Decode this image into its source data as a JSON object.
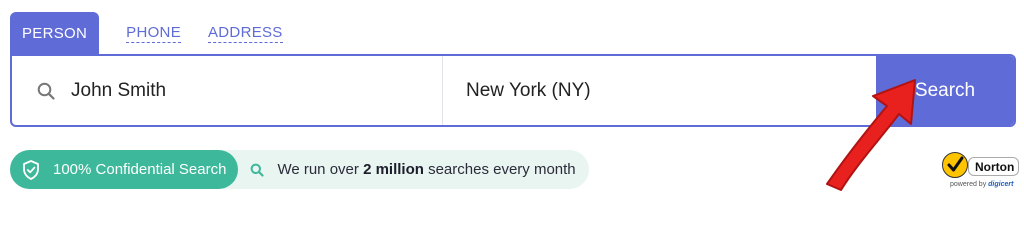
{
  "tabs": [
    {
      "label": "PERSON",
      "active": true
    },
    {
      "label": "PHONE",
      "active": false
    },
    {
      "label": "ADDRESS",
      "active": false
    }
  ],
  "search": {
    "name_value": "John Smith",
    "location_value": "New York (NY)",
    "button_label": "Search"
  },
  "badges": {
    "confidential_label": "100% Confidential Search",
    "stats_prefix": "We run over",
    "stats_bold": "2 million",
    "stats_suffix": "searches every month"
  },
  "norton": {
    "logo_text": "Norton",
    "powered_by": "powered by",
    "digicert": "digicert"
  },
  "colors": {
    "accent": "#5f6bd6",
    "confidential_green": "#3db89a",
    "stats_bg": "#e9f5f1",
    "arrow_red": "#e8201e"
  },
  "icons": [
    "search-icon",
    "shield-check-icon",
    "norton-check-icon"
  ]
}
